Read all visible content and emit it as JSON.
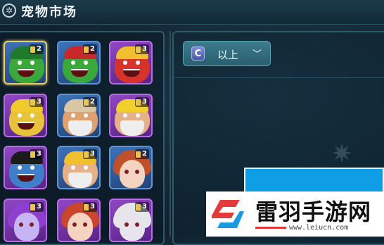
{
  "header": {
    "title": "宠物市场",
    "icon": "gear-icon"
  },
  "pets": [
    {
      "rank": "2",
      "frame": "blue",
      "selected": true,
      "kind": "goblin",
      "skin": "#3aa83a",
      "hat": "#1f7a2c"
    },
    {
      "rank": "2",
      "frame": "blue",
      "selected": false,
      "kind": "goblin",
      "skin": "#3aa83a",
      "hat": "#c8282a"
    },
    {
      "rank": "3",
      "frame": "purple",
      "selected": false,
      "kind": "goblin",
      "skin": "#d8322c",
      "hat": "#f2c02e"
    },
    {
      "rank": "3",
      "frame": "purple",
      "selected": false,
      "kind": "miner",
      "skin": "#e8c23a",
      "hat": "#f0c92c"
    },
    {
      "rank": "2",
      "frame": "blue",
      "selected": false,
      "kind": "dwarf",
      "skin": "#e0a070",
      "hat": "#d9c7a4"
    },
    {
      "rank": "3",
      "frame": "purple",
      "selected": false,
      "kind": "dwarf",
      "skin": "#e6b088",
      "hat": "#f2cf2a"
    },
    {
      "rank": "3",
      "frame": "purple",
      "selected": false,
      "kind": "pirate",
      "skin": "#3f7ec8",
      "hat": "#1a1a1a"
    },
    {
      "rank": "3",
      "frame": "blue",
      "selected": false,
      "kind": "dwarf",
      "skin": "#e6b088",
      "hat": "#f2c02e"
    },
    {
      "rank": "2",
      "frame": "blue",
      "selected": false,
      "kind": "girl",
      "skin": "#f4d4c0",
      "hat": "#c0502a"
    },
    {
      "rank": "3",
      "frame": "purple",
      "selected": false,
      "kind": "girl",
      "skin": "#c6b4f4",
      "hat": "#8e3fcf"
    },
    {
      "rank": "3",
      "frame": "purple",
      "selected": false,
      "kind": "girl",
      "skin": "#f4d4c0",
      "hat": "#c9452c"
    },
    {
      "rank": "3",
      "frame": "purple",
      "selected": false,
      "kind": "girl",
      "skin": "#e8e4ee",
      "hat": "#e6e6ea"
    }
  ],
  "filter": {
    "grade": "C",
    "label": "以上",
    "icon": "chevron-down-icon"
  },
  "watermark": {
    "title": "雷羽手游网",
    "url": "www.leiucn.com"
  }
}
